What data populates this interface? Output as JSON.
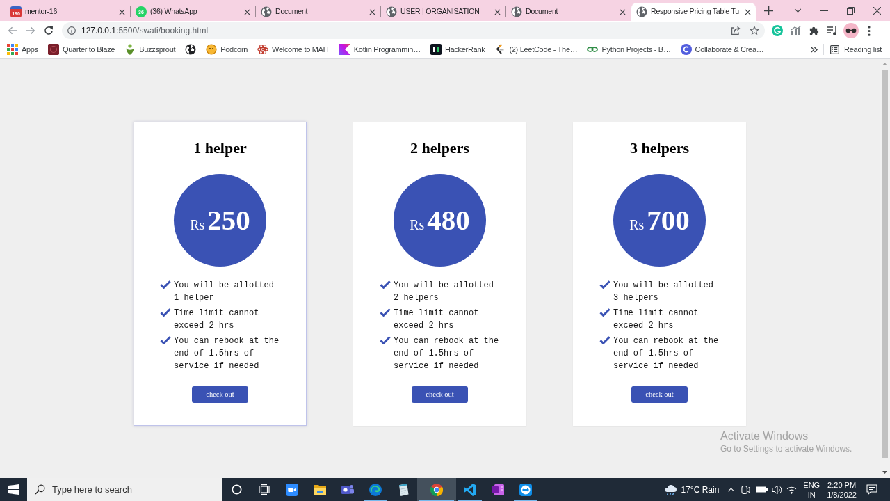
{
  "browser": {
    "tabs": [
      {
        "title": "mentor-16",
        "badge": "190",
        "selected": false
      },
      {
        "title": "(36) WhatsApp",
        "badge": "36",
        "selected": false
      },
      {
        "title": "Document",
        "selected": false
      },
      {
        "title": "USER | ORGANISATION",
        "selected": false
      },
      {
        "title": "Document",
        "selected": false
      },
      {
        "title": "Responsive Pricing Table Tu",
        "selected": true
      }
    ],
    "address": {
      "host": "127.0.0.1",
      "path": ":5500/swati/booking.html"
    },
    "bookmarks": [
      {
        "kind": "link",
        "label": "Apps"
      },
      {
        "kind": "link",
        "label": "Quarter to Blaze"
      },
      {
        "kind": "link",
        "label": "Buzzsprout"
      },
      {
        "kind": "icon"
      },
      {
        "kind": "link",
        "label": "Podcorn"
      },
      {
        "kind": "link",
        "label": "Welcome to MAIT"
      },
      {
        "kind": "link",
        "label": "Kotlin Programmin…"
      },
      {
        "kind": "link",
        "label": "HackerRank"
      },
      {
        "kind": "link",
        "label": "(2) LeetCode - The…"
      },
      {
        "kind": "link",
        "label": "Python Projects - B…"
      },
      {
        "kind": "link",
        "label": "Collaborate & Crea…"
      }
    ],
    "reading_list": "Reading list"
  },
  "plans": [
    {
      "title": "1 helper",
      "currency": "Rs",
      "price": "250",
      "features": [
        "You will be allotted 1 helper",
        "Time limit cannot exceed 2 hrs",
        "You can rebook at the end of 1.5hrs of service if needed"
      ],
      "button": "check out",
      "highlighted": true
    },
    {
      "title": "2 helpers",
      "currency": "Rs",
      "price": "480",
      "features": [
        "You will be allotted 2 helpers",
        "Time limit cannot exceed 2 hrs",
        "You can rebook at the end of 1.5hrs of service if needed"
      ],
      "button": "check out",
      "highlighted": false
    },
    {
      "title": "3 helpers",
      "currency": "Rs",
      "price": "700",
      "features": [
        "You will be allotted 3 helpers",
        "Time limit cannot exceed 2 hrs",
        "You can rebook at the end of 1.5hrs of service if needed"
      ],
      "button": "check out",
      "highlighted": false
    }
  ],
  "activation_notice": {
    "title": "Activate Windows",
    "message": "Go to Settings to activate Windows."
  },
  "taskbar": {
    "search": {
      "placeholder": "Type here to search"
    },
    "apps": [
      {
        "running": false,
        "selected": false
      },
      {
        "running": false,
        "selected": false
      },
      {
        "running": false,
        "selected": false
      },
      {
        "running": true,
        "selected": false
      },
      {
        "running": false,
        "selected": false
      },
      {
        "running": true,
        "selected": true
      },
      {
        "running": true,
        "selected": false
      },
      {
        "running": false,
        "selected": false
      },
      {
        "running": true,
        "selected": false
      }
    ],
    "weather": "17°C Rain",
    "language": "ENG",
    "region": "IN",
    "time": "2:20 PM",
    "date": "1/8/2022"
  }
}
